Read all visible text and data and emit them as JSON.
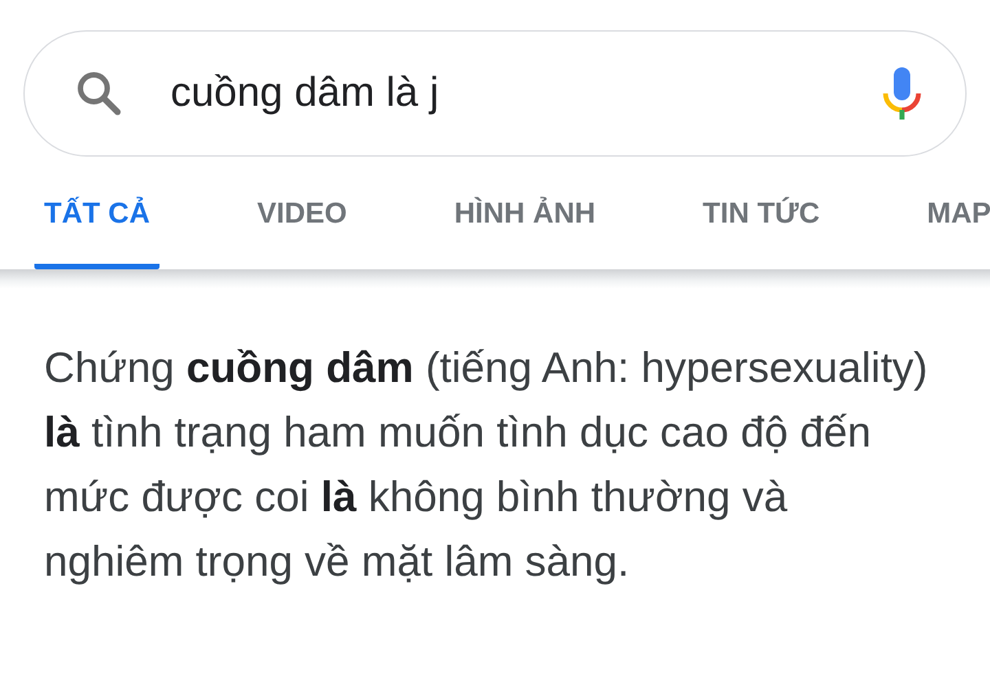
{
  "search": {
    "value": "cuồng dâm là j"
  },
  "tabs": [
    {
      "label": "TẤT CẢ",
      "selected": true
    },
    {
      "label": "VIDEO",
      "selected": false
    },
    {
      "label": "HÌNH ẢNH",
      "selected": false
    },
    {
      "label": "TIN TỨC",
      "selected": false
    },
    {
      "label": "MAP",
      "selected": false
    }
  ],
  "answer": "Chứng **cuồng dâm** (tiếng Anh: hypersexuality) **là** tình trạng ham muốn tình dục cao độ đến mức được coi **là** không bình thường và nghiêm trọng về mặt lâm sàng."
}
